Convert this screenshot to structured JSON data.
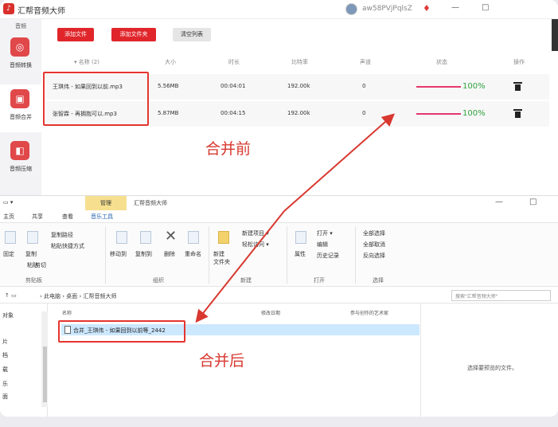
{
  "app": {
    "title": "汇帮音频大师",
    "user_name": "aw58PVjPqlsZ",
    "window_controls": [
      "—",
      "□"
    ]
  },
  "sidebar": {
    "top_label": "音频",
    "items": [
      {
        "label": "音频转换",
        "icon": "convert-icon"
      },
      {
        "label": "音频合并",
        "icon": "merge-icon"
      },
      {
        "label": "音频压缩",
        "icon": "compress-icon"
      }
    ]
  },
  "toolbar": {
    "add_file": "添加文件",
    "add_folder": "添加文件夹",
    "clear_list": "清空列表"
  },
  "table": {
    "columns": [
      "▾ 名称 (2)",
      "大小",
      "时长",
      "比特率",
      "声道",
      "状态",
      "操作"
    ],
    "rows": [
      {
        "name": "王琪伟 - 如果回到以前.mp3",
        "size": "5.56MB",
        "duration": "00:04:01",
        "bitrate": "192.00k",
        "channels": "0",
        "progress": 100,
        "progress_text": "100%"
      },
      {
        "name": "张智霖 - 再拥抱可以.mp3",
        "size": "5.87MB",
        "duration": "00:04:15",
        "bitrate": "192.00k",
        "channels": "0",
        "progress": 100,
        "progress_text": "100%"
      }
    ]
  },
  "annotations": {
    "before": "合并前",
    "after": "合并后"
  },
  "explorer": {
    "manage_tab": "管理",
    "window_title": "汇帮音频大师",
    "ribbon_tabs": [
      "主页",
      "共享",
      "查看",
      "音乐工具"
    ],
    "ribbon": {
      "copy_path": "复制路径",
      "paste_shortcut": "粘贴快捷方式",
      "pin": "固定",
      "copy": "复制",
      "paste": "粘贴",
      "cut": "剪切",
      "move_to": "移动到",
      "copy_to": "复制到",
      "delete": "删除",
      "rename": "重命名",
      "new_folder": "新建\n文件夹",
      "new_item": "新建项目 ▾",
      "easy_access": "轻松访问 ▾",
      "properties": "属性",
      "open": "打开 ▾",
      "edit": "编辑",
      "history": "历史记录",
      "select_all": "全部选择",
      "select_none": "全部取消",
      "invert": "反向选择",
      "groups": [
        "剪贴板",
        "组织",
        "新建",
        "打开",
        "选择"
      ]
    },
    "address": {
      "path": "› 此电脑 › 桌面 › 汇帮音频大师",
      "search_placeholder": "搜索\"汇帮音频大师\""
    },
    "list_headers": [
      "名称",
      "修改日期",
      "参与创作的艺术家"
    ],
    "file_name": "合并_王琪伟 - 如果回到以前等_2442",
    "nav_items": [
      "对象",
      "片",
      "档",
      "载",
      "乐",
      "面"
    ],
    "preview_text": "选择要预览的文件。"
  }
}
